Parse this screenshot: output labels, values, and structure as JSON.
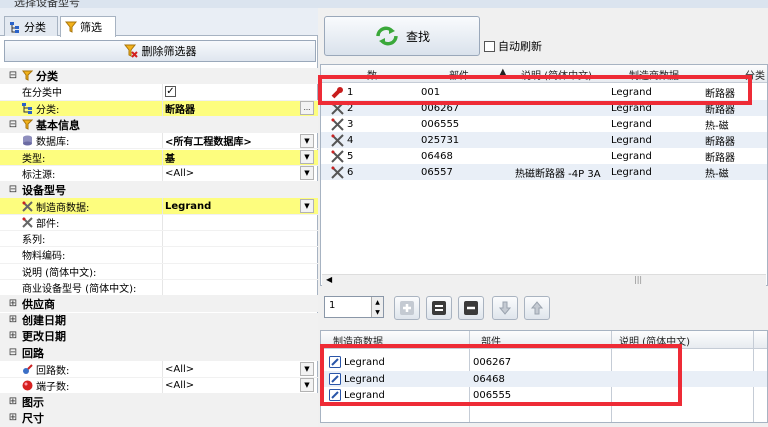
{
  "window": {
    "title": "选择设备型号"
  },
  "tabs": [
    {
      "label": "分类",
      "icon": "tree-icon"
    },
    {
      "label": "筛选",
      "icon": "funnel-icon"
    }
  ],
  "clear_filter": {
    "label": "删除筛选器"
  },
  "filters": {
    "category": {
      "header": "分类",
      "in_category_label": "在分类中",
      "in_category_value": "✓",
      "category_label": "分类:",
      "category_value": "断路器"
    },
    "basic": {
      "header": "基本信息",
      "database_label": "数据库:",
      "database_value": "<所有工程数据库>",
      "type_label": "类型:",
      "type_value": "基",
      "std_label": "标注源:",
      "std_value": "<All>"
    },
    "device": {
      "header": "设备型号",
      "manufacturer_label": "制造商数据:",
      "manufacturer_value": "Legrand",
      "part_label": "部件:",
      "series_label": "系列:",
      "material_label": "物料编码:",
      "desc_label": "说明 (简体中文):",
      "commercial_label": "商业设备型号 (简体中文):"
    },
    "supplier": {
      "header": "供应商"
    },
    "created": {
      "header": "创建日期"
    },
    "changed": {
      "header": "更改日期"
    },
    "circuit": {
      "header": "回路",
      "circuits_label": "回路数:",
      "circuits_value": "<All>",
      "terminals_label": "端子数:",
      "terminals_value": "<All>"
    },
    "figure": {
      "header": "图示"
    },
    "size": {
      "header": "尺寸"
    }
  },
  "find_button": {
    "label": "查找"
  },
  "auto_refresh": {
    "label": "自动刷新",
    "checked": false
  },
  "results": {
    "columns": [
      "数",
      "部件",
      "说明 (简体中文)",
      "制造商数据",
      "分类"
    ],
    "rows": [
      {
        "num": "1",
        "part": "001",
        "desc": "",
        "mfr": "Legrand",
        "cat": "断路器"
      },
      {
        "num": "2",
        "part": "006267",
        "desc": "",
        "mfr": "Legrand",
        "cat": "断路器"
      },
      {
        "num": "3",
        "part": "006555",
        "desc": "",
        "mfr": "Legrand",
        "cat": "热-磁"
      },
      {
        "num": "4",
        "part": "025731",
        "desc": "",
        "mfr": "Legrand",
        "cat": "断路器"
      },
      {
        "num": "5",
        "part": "06468",
        "desc": "",
        "mfr": "Legrand",
        "cat": "断路器"
      },
      {
        "num": "6",
        "part": "06557",
        "desc": "热磁断路器 -4P 3A",
        "mfr": "Legrand",
        "cat": "热-磁"
      }
    ]
  },
  "quantity": {
    "value": "1"
  },
  "selected": {
    "columns": [
      "制造商数据",
      "部件",
      "说明 (简体中文)"
    ],
    "rows": [
      {
        "mfr": "Legrand",
        "part": "006267"
      },
      {
        "mfr": "Legrand",
        "part": "06468"
      },
      {
        "mfr": "Legrand",
        "part": "006555"
      }
    ]
  },
  "colors": {
    "highlight": "#fdfd7e",
    "annotation": "#ee2b36",
    "row_alt": "#e9eff7"
  }
}
